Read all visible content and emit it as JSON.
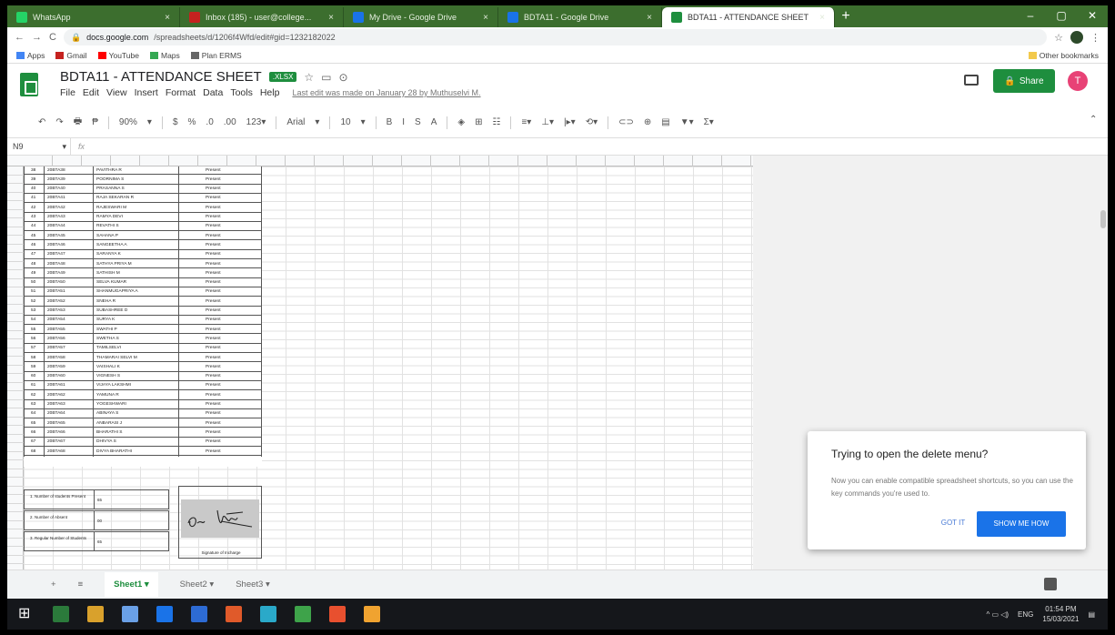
{
  "browser": {
    "tabs": [
      {
        "label": "WhatsApp",
        "color": "#25d366"
      },
      {
        "label": "Inbox (185) - user@college...",
        "color": "#c5221f"
      },
      {
        "label": "My Drive - Google Drive",
        "color": "#1a73e8"
      },
      {
        "label": "BDTA11 - Google Drive",
        "color": "#1a73e8"
      },
      {
        "label": "BDTA11 - ATTENDANCE SHEET",
        "color": "#1e8e3e"
      }
    ],
    "url_host": "docs.google.com",
    "url_path": "/spreadsheets/d/1206f4Wfd/edit#gid=1232182022",
    "bookmarks": [
      {
        "label": "Apps",
        "color": "#4285f4"
      },
      {
        "label": "Gmail",
        "color": "#c5221f"
      },
      {
        "label": "YouTube",
        "color": "#ff0000"
      },
      {
        "label": "Maps",
        "color": "#34a853"
      },
      {
        "label": "Plan ERMS",
        "color": "#666666"
      }
    ],
    "other_bookmarks": "Other bookmarks",
    "new_tab": "+",
    "win_minimize": "–",
    "win_maximize": "▢",
    "win_close": "✕"
  },
  "doc": {
    "title": "BDTA11 - ATTENDANCE SHEET",
    "badge": ".XLSX",
    "menu": [
      "File",
      "Edit",
      "View",
      "Insert",
      "Format",
      "Data",
      "Tools",
      "Help"
    ],
    "last_edit": "Last edit was made on January 28 by Muthuselvi M.",
    "share_label": "Share",
    "avatar_letter": "T",
    "toolbar_items": [
      "↶",
      "↷",
      "🖶",
      "₱",
      "|",
      "90%",
      "▾",
      "|",
      "$",
      "%",
      ".0",
      ".00",
      "123▾",
      "|",
      "Arial",
      "▾",
      "|",
      "10",
      "▾",
      "|",
      "B",
      "I",
      "S",
      "A",
      "|",
      "◈",
      "⊞",
      "☷",
      "|",
      "≡▾",
      "⊥▾",
      "|▸▾",
      "⟲▾",
      "|",
      "⊂⊃",
      "⊕",
      "▤",
      "▼▾",
      "Σ▾"
    ]
  },
  "formula": {
    "cell": "N9",
    "fx": "fx"
  },
  "sheet": {
    "rows": [
      {
        "n": "38",
        "roll": "20BTA38",
        "name": "PAVITHRA R",
        "status": "Present"
      },
      {
        "n": "39",
        "roll": "20BTA39",
        "name": "POORNIMA S",
        "status": "Present"
      },
      {
        "n": "40",
        "roll": "20BTA40",
        "name": "PRASANNA S",
        "status": "Present"
      },
      {
        "n": "41",
        "roll": "20BTA41",
        "name": "RAJA SEKARAN R",
        "status": "Present"
      },
      {
        "n": "42",
        "roll": "20BTA42",
        "name": "RAJESWARI M",
        "status": "Present"
      },
      {
        "n": "43",
        "roll": "20BTA43",
        "name": "RAMYA DEVI",
        "status": "Present"
      },
      {
        "n": "44",
        "roll": "20BTA44",
        "name": "REVATHI S",
        "status": "Present"
      },
      {
        "n": "45",
        "roll": "20BTA45",
        "name": "SAHANA P",
        "status": "Present"
      },
      {
        "n": "46",
        "roll": "20BTA46",
        "name": "SANGEETHA A",
        "status": "Present"
      },
      {
        "n": "47",
        "roll": "20BTA47",
        "name": "SARANYA K",
        "status": "Present"
      },
      {
        "n": "48",
        "roll": "20BTA48",
        "name": "SATHYA PRIYA M",
        "status": "Present"
      },
      {
        "n": "49",
        "roll": "20BTA49",
        "name": "SATHISH M",
        "status": "Present"
      },
      {
        "n": "50",
        "roll": "20BTA50",
        "name": "SELVA KUMAR",
        "status": "Present"
      },
      {
        "n": "51",
        "roll": "20BTA51",
        "name": "SHANMUGAPRIYA A",
        "status": "Present"
      },
      {
        "n": "52",
        "roll": "20BTA52",
        "name": "SNEHA R",
        "status": "Present"
      },
      {
        "n": "53",
        "roll": "20BTA53",
        "name": "SUBASHREE D",
        "status": "Present"
      },
      {
        "n": "54",
        "roll": "20BTA54",
        "name": "SURYA K",
        "status": "Present"
      },
      {
        "n": "55",
        "roll": "20BTA55",
        "name": "SWATHI P",
        "status": "Present"
      },
      {
        "n": "56",
        "roll": "20BTA56",
        "name": "SWETHA S",
        "status": "Present"
      },
      {
        "n": "57",
        "roll": "20BTA57",
        "name": "TAMILSELVI",
        "status": "Present"
      },
      {
        "n": "58",
        "roll": "20BTA58",
        "name": "THAMARAI SELVI M",
        "status": "Present"
      },
      {
        "n": "59",
        "roll": "20BTA59",
        "name": "VAISHALI K",
        "status": "Present"
      },
      {
        "n": "60",
        "roll": "20BTA60",
        "name": "VIGNESH S",
        "status": "Present"
      },
      {
        "n": "61",
        "roll": "20BTA61",
        "name": "VIJAYA LAKSHMI",
        "status": "Present"
      },
      {
        "n": "62",
        "roll": "20BTA62",
        "name": "YAMUNA R",
        "status": "Present"
      },
      {
        "n": "63",
        "roll": "20BTA63",
        "name": "YOGESHWARI",
        "status": "Present"
      },
      {
        "n": "64",
        "roll": "20BTA64",
        "name": "ABINAYA S",
        "status": "Present"
      },
      {
        "n": "65",
        "roll": "20BTA65",
        "name": "ANBARASI J",
        "status": "Present"
      },
      {
        "n": "66",
        "roll": "20BTA66",
        "name": "BHARATHI S",
        "status": "Present"
      },
      {
        "n": "67",
        "roll": "20BTA67",
        "name": "DHIVYA S",
        "status": "Present"
      },
      {
        "n": "68",
        "roll": "20BTA68",
        "name": "DIVYA BHARATHI",
        "status": "Present"
      }
    ],
    "summary": [
      {
        "label": "1. Number of students Present",
        "value": "65"
      },
      {
        "label": "2. Number of Absent",
        "value": "00"
      },
      {
        "label": "3. Regular Number of Students",
        "value": "65"
      }
    ],
    "signature_caption": "Signature of Incharge"
  },
  "popup": {
    "title": "Trying to open the delete menu?",
    "body": "Now you can enable compatible spreadsheet shortcuts, so you can use the key commands you're used to.",
    "dismiss": "GOT IT",
    "action": "SHOW ME HOW"
  },
  "sheettabs": [
    {
      "label": "+"
    },
    {
      "label": "≡"
    },
    {
      "label": "Sheet1 ▾"
    },
    {
      "label": "Sheet2 ▾"
    },
    {
      "label": "Sheet3 ▾"
    }
  ],
  "taskbar": {
    "apps": [
      "#1f6fd1",
      "#2b7a3b",
      "#d9a12c",
      "#6aa0e6",
      "#1a73e8",
      "#2d6bd4",
      "#e05a2a",
      "#2aa9c9",
      "#3ea34a",
      "#e8502f",
      "#f0a330"
    ],
    "lang": "ENG",
    "time": "01:54 PM",
    "date": "15/03/2021"
  }
}
